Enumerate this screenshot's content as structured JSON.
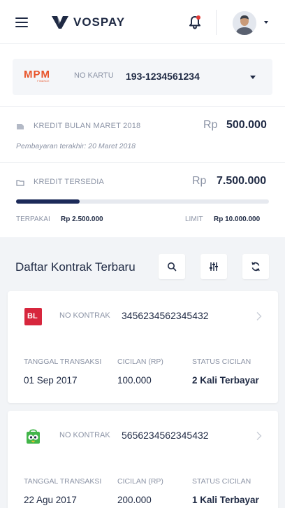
{
  "header": {
    "brand": "VOSPAY",
    "menu_icon": "hamburger-menu-icon",
    "notification_icon": "bell-icon",
    "has_unread": true,
    "accent": "#1f2a44",
    "alert_color": "#e53935"
  },
  "card": {
    "issuer_logo": "MPM",
    "issuer_logo_sub": "FINANCE",
    "label": "NO KARTU",
    "number": "193-1234561234"
  },
  "credit_month": {
    "label": "KREDIT BULAN MARET 2018",
    "currency": "Rp",
    "amount": "500.000",
    "due": "Pembayaran terakhir: 20 Maret 2018"
  },
  "credit_available": {
    "label": "KREDIT TERSEDIA",
    "currency": "Rp",
    "amount": "7.500.000",
    "used_label": "TERPAKAI",
    "used_value": "Rp 2.500.000",
    "limit_label": "LIMIT",
    "limit_value": "Rp 10.000.000",
    "used_fraction": 0.25
  },
  "contracts": {
    "title": "Daftar Kontrak Terbaru",
    "tools": [
      "search-icon",
      "filter-icon",
      "refresh-icon"
    ],
    "columns": {
      "date": "TANGGAL TRANSAKSI",
      "installment": "CICILAN (RP)",
      "status": "STATUS CICILAN"
    },
    "items": [
      {
        "merchant": "BL",
        "merchant_color": "#d7263d",
        "label": "NO KONTRAK",
        "number": "3456234562345432",
        "date": "01 Sep 2017",
        "installment": "100.000",
        "status": "2 Kali Terbayar"
      },
      {
        "merchant": "tokopedia",
        "merchant_color": "#42b549",
        "label": "NO KONTRAK",
        "number": "5656234562345432",
        "date": "22 Agu 2017",
        "installment": "200.000",
        "status": "1 Kali Terbayar"
      }
    ]
  }
}
